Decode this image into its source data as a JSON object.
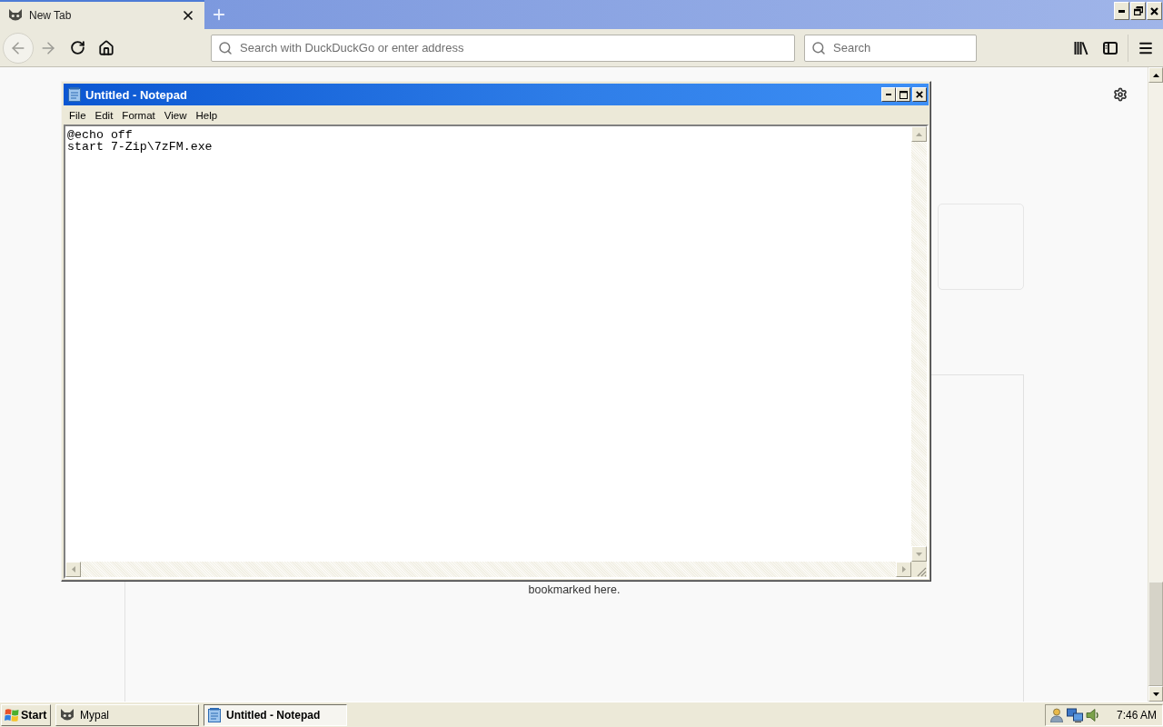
{
  "browser": {
    "tabs": [
      {
        "label": "New Tab",
        "selected": true
      }
    ],
    "nav_buttons": [
      {
        "kind": "back",
        "disabled": true
      },
      {
        "kind": "forward",
        "disabled": true
      },
      {
        "kind": "reload",
        "disabled": false
      },
      {
        "kind": "home",
        "disabled": false
      }
    ],
    "address_bar": {
      "placeholder": "Search with DuckDuckGo or enter address"
    },
    "search_bar": {
      "placeholder": "Search"
    }
  },
  "new_tab_page": {
    "message": "bookmarked here."
  },
  "notepad": {
    "title": "Untitled - Notepad",
    "menu": [
      "File",
      "Edit",
      "Format",
      "View",
      "Help"
    ],
    "lines": [
      "@echo off",
      "start 7-Zip\\7zFM.exe"
    ]
  },
  "taskbar": {
    "start": "Start",
    "tasks": [
      {
        "kind": "browser",
        "label": "Mypal",
        "selected": false
      },
      {
        "kind": "notepad",
        "label": "Untitled - Notepad",
        "selected": true
      }
    ],
    "clock": "7:46 AM"
  }
}
